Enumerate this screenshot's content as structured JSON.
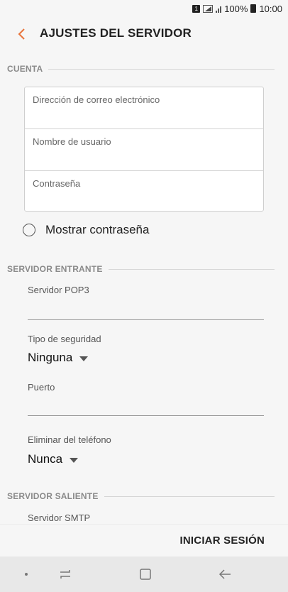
{
  "status_bar": {
    "sim_label": "1",
    "battery": "100%",
    "time": "10:00"
  },
  "header": {
    "title": "AJUSTES DEL SERVIDOR",
    "back_icon": "chevron-left-icon",
    "accent_color": "#e8733a"
  },
  "account": {
    "section_label": "CUENTA",
    "email_placeholder": "Dirección de correo electrónico",
    "username_placeholder": "Nombre de usuario",
    "password_placeholder": "Contraseña",
    "show_password_label": "Mostrar contraseña",
    "show_password_checked": false
  },
  "incoming": {
    "section_label": "SERVIDOR ENTRANTE",
    "server_label": "Servidor POP3",
    "server_value": "",
    "security_label": "Tipo de seguridad",
    "security_value": "Ninguna",
    "port_label": "Puerto",
    "port_value": "",
    "delete_label": "Eliminar del teléfono",
    "delete_value": "Nunca"
  },
  "outgoing": {
    "section_label": "SERVIDOR SALIENTE",
    "server_label": "Servidor SMTP"
  },
  "actions": {
    "sign_in_label": "INICIAR SESIÓN"
  },
  "nav_bar": {
    "items": [
      "dot-icon",
      "recent-apps-icon",
      "home-icon",
      "back-arrow-icon"
    ]
  }
}
